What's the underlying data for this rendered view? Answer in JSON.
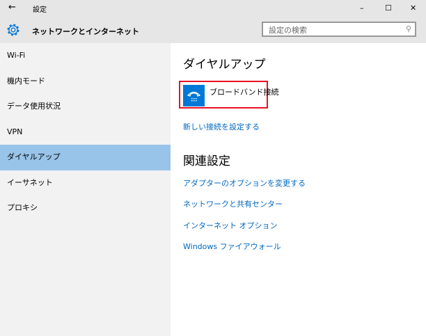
{
  "window": {
    "title": "設定",
    "back": "←",
    "minimize": "–",
    "maximize": "☐",
    "close": "✕"
  },
  "header": {
    "title": "ネットワークとインターネット",
    "search_placeholder": "設定の検索"
  },
  "sidebar": {
    "items": [
      {
        "label": "Wi-Fi"
      },
      {
        "label": "機内モード"
      },
      {
        "label": "データ使用状況"
      },
      {
        "label": "VPN"
      },
      {
        "label": "ダイヤルアップ"
      },
      {
        "label": "イーサネット"
      },
      {
        "label": "プロキシ"
      }
    ]
  },
  "main": {
    "heading": "ダイヤルアップ",
    "connection": "ブロードバンド接続",
    "new_connection": "新しい接続を設定する",
    "related_heading": "関連設定",
    "related": [
      "アダプターのオプションを変更する",
      "ネットワークと共有センター",
      "インターネット オプション",
      "Windows ファイアウォール"
    ]
  },
  "colors": {
    "accent": "#0078d7",
    "selected": "#99c4ea",
    "highlight_box": "#e81123"
  }
}
